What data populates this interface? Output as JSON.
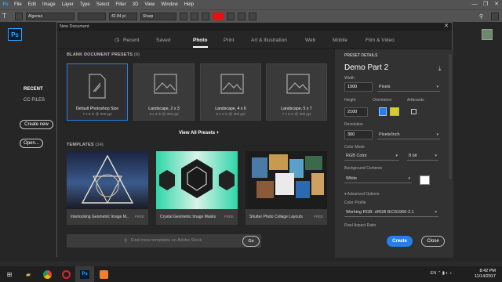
{
  "app": {
    "logo": "Ps"
  },
  "menubar": {
    "items": [
      "File",
      "Edit",
      "Image",
      "Layer",
      "Type",
      "Select",
      "Filter",
      "3D",
      "View",
      "Window",
      "Help"
    ],
    "controls": [
      "—",
      "❐",
      "✕"
    ]
  },
  "options_bar": {
    "font_family": "Algerian",
    "font_size": "42.84 pt",
    "antialias": "Sharp"
  },
  "home": {
    "recent": "RECENT",
    "cc_files": "CC FILES",
    "create_new": "Create new",
    "open": "Open..."
  },
  "dialog": {
    "title": "New Document",
    "tabs": [
      {
        "label": "Recent"
      },
      {
        "label": "Saved"
      },
      {
        "label": "Photo"
      },
      {
        "label": "Print"
      },
      {
        "label": "Art & Illustration"
      },
      {
        "label": "Web"
      },
      {
        "label": "Mobile"
      },
      {
        "label": "Film & Video"
      }
    ],
    "active_tab": "Photo",
    "blank_presets_label": "BLANK DOCUMENT PRESETS",
    "blank_presets_count": "(9)",
    "presets": [
      {
        "name": "Default Photoshop Size",
        "dims": "7 x 5 in @ 300 ppi"
      },
      {
        "name": "Landscape, 2 x 3",
        "dims": "3 x 2 in @ 300 ppi"
      },
      {
        "name": "Landscape, 4 x 6",
        "dims": "6 x 4 in @ 300 ppi"
      },
      {
        "name": "Landscape, 5 x 7",
        "dims": "7 x 5 in @ 300 ppi"
      }
    ],
    "view_all": "View All Presets +",
    "templates_label": "TEMPLATES",
    "templates_count": "(14)",
    "templates": [
      {
        "name": "Interlocking Geometric Image M...",
        "badge": "FREE"
      },
      {
        "name": "Crystal Geometric Image Masks",
        "badge": "FREE"
      },
      {
        "name": "Shutter Photo Collage Layouts",
        "badge": "FREE"
      }
    ],
    "stock_search_placeholder": "Find more templates on Adobe Stock",
    "go": "Go"
  },
  "preset_details": {
    "heading": "PRESET DETAILS",
    "doc_name": "Demo Part 2",
    "width_label": "Width",
    "width_value": "1500",
    "width_unit": "Pixels",
    "height_label": "Height",
    "height_value": "2100",
    "orientation_label": "Orientation",
    "artboards_label": "Artboards",
    "resolution_label": "Resolution",
    "resolution_value": "300",
    "resolution_unit": "Pixels/Inch",
    "color_mode_label": "Color Mode",
    "color_mode_value": "RGB Color",
    "bit_depth": "8 bit",
    "background_label": "Background Contents",
    "background_value": "White",
    "advanced_label": "Advanced Options",
    "color_profile_label": "Color Profile",
    "color_profile_value": "Working RGB: sRGB IEC61966-2.1",
    "pixel_aspect_label": "Pixel Aspect Ratio",
    "create": "Create",
    "close": "Close"
  },
  "taskbar": {
    "lang": "EN",
    "time": "8:42 PM",
    "date": "11/14/2017"
  }
}
